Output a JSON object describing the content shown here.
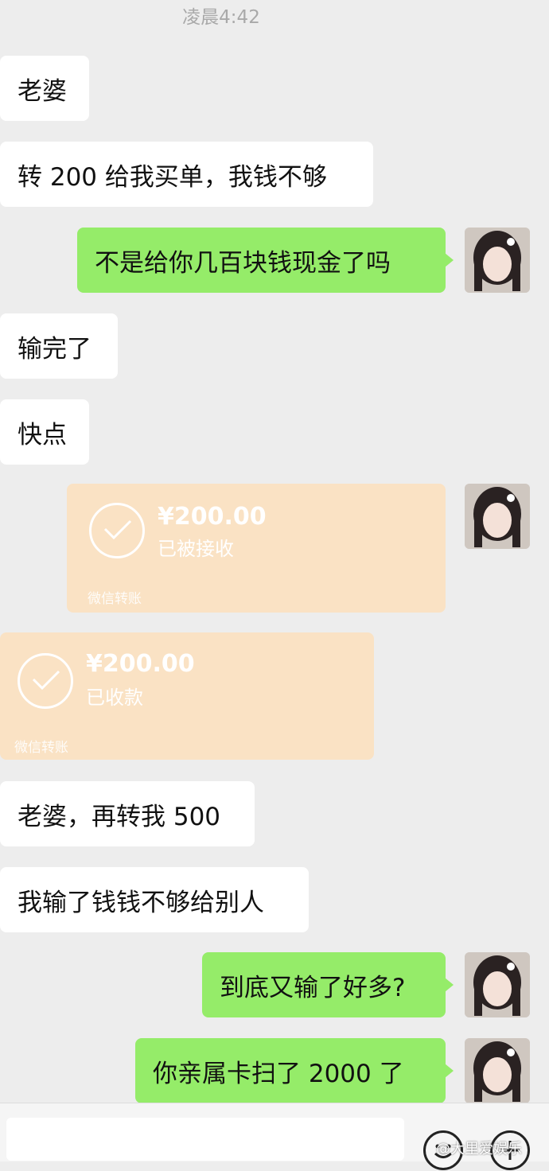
{
  "timestamp": "凌晨4:42",
  "messages": [
    {
      "text": "老婆"
    },
    {
      "text": "转 200 给我买单，我钱不够"
    },
    {
      "text": "不是给你几百块钱现金了吗"
    },
    {
      "text": "输完了"
    },
    {
      "text": "快点"
    },
    {
      "text": "老婆，再转我 500"
    },
    {
      "text": "我输了钱钱不够给别人"
    },
    {
      "text": "到底又输了好多?"
    },
    {
      "text": "你亲属卡扫了 2000 了"
    }
  ],
  "transfers": [
    {
      "amount": "¥200.00",
      "status": "已被接收",
      "footer": "微信转账"
    },
    {
      "amount": "¥200.00",
      "status": "已收款",
      "footer": "微信转账"
    }
  ],
  "watermark": "@大里爱娱乐",
  "icons": {
    "avatar": "avatar-photo",
    "check": "check-icon",
    "emoji": "emoji-icon",
    "plus": "plus-icon"
  },
  "colors": {
    "background": "#ededed",
    "outgoing": "#95ec69",
    "incoming": "#ffffff",
    "transfer": "#fae2c4"
  }
}
